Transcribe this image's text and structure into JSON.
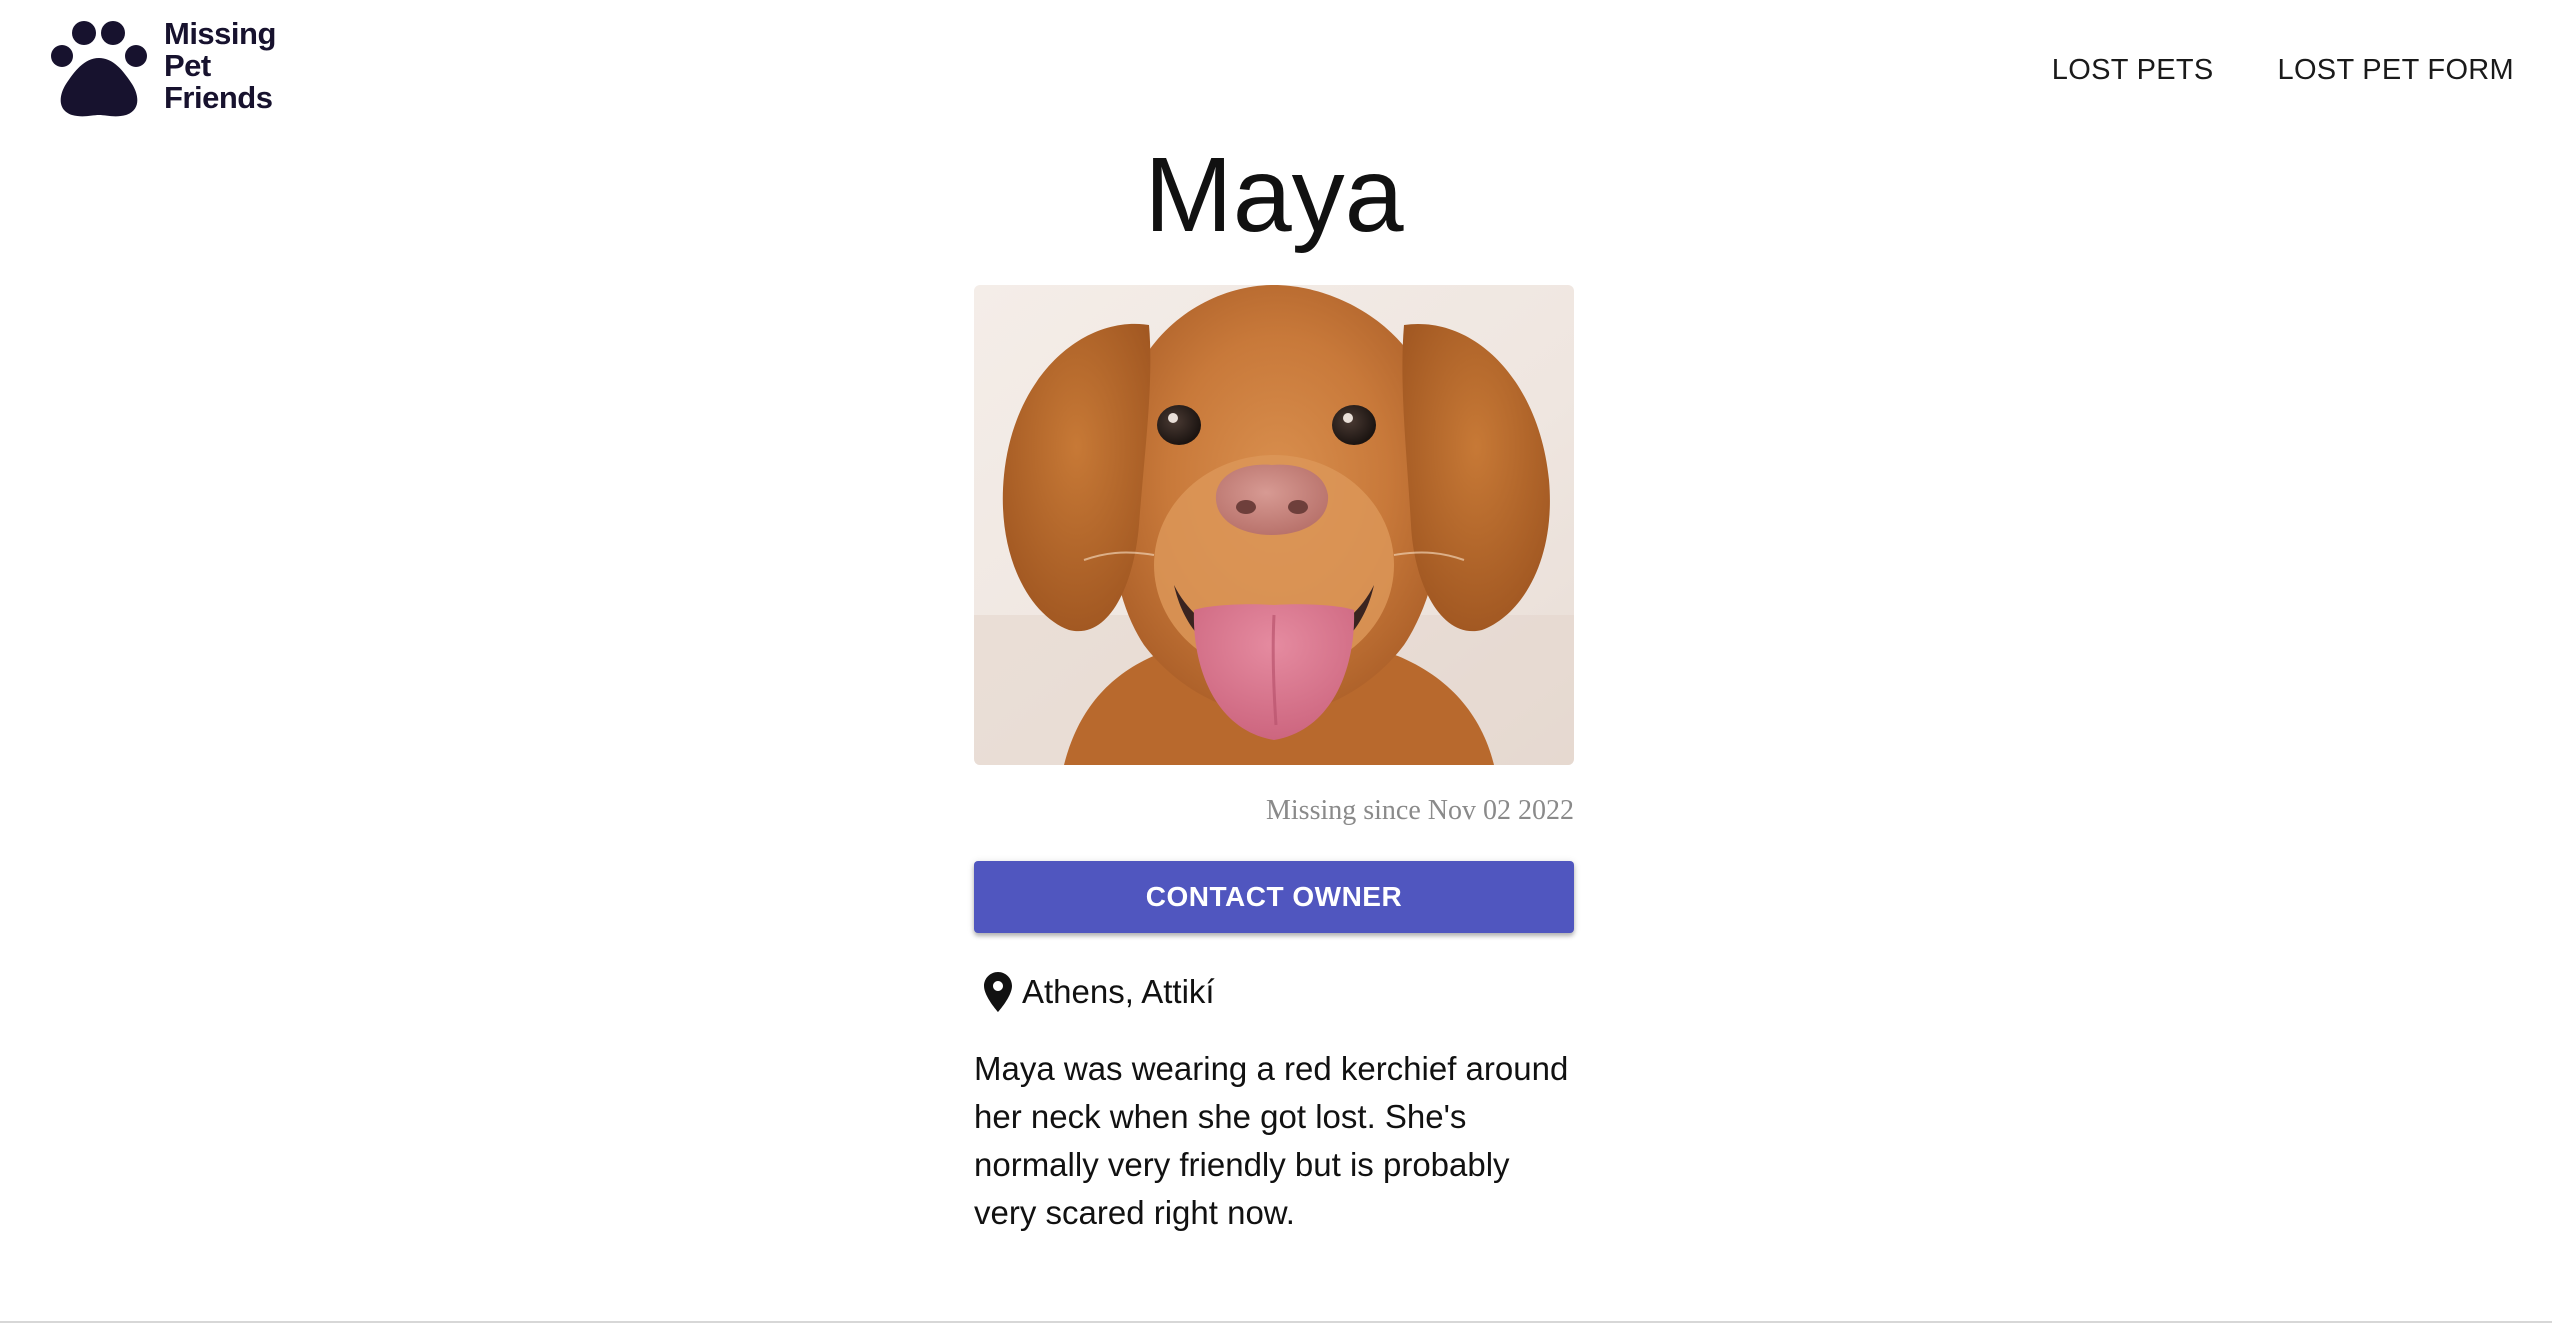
{
  "brand": {
    "logo_icon": "paw-icon",
    "line1": "Missing",
    "line2": "Pet",
    "line3": "Friends",
    "color": "#17122e"
  },
  "nav": {
    "items": [
      {
        "label": "LOST PETS"
      },
      {
        "label": "LOST PET FORM"
      }
    ]
  },
  "pet": {
    "name": "Maya",
    "photo_alt": "Maya",
    "missing_since": "Missing since Nov 02 2022",
    "location_icon": "map-pin-icon",
    "location": "Athens, Attikí",
    "description": "Maya was wearing a red kerchief around her neck when she got lost. She's normally very friendly but is probably very scared right now."
  },
  "actions": {
    "contact_label": "CONTACT OWNER",
    "contact_color": "#5056bf"
  }
}
